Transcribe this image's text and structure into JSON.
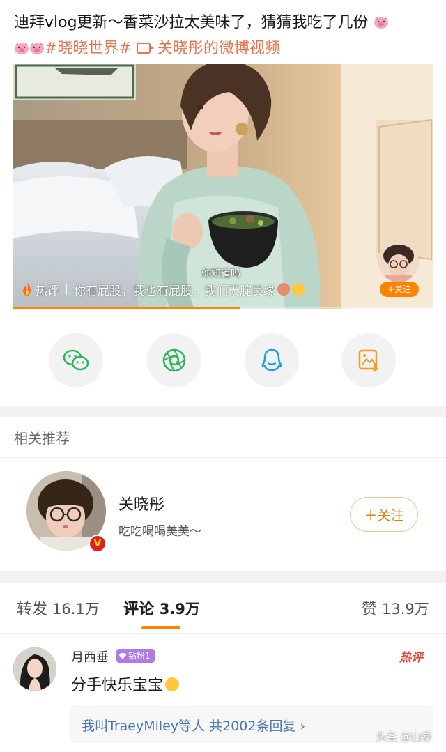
{
  "post": {
    "line1": "迪拜vlog更新～香菜沙拉太美味了，猜猜我吃了几份",
    "topic": "#晓晓世界#",
    "video_link": "关晓彤的微博视频"
  },
  "video": {
    "caption": "你知道吗",
    "hot_label": "热评",
    "hot_comment": "你有屁股，我也有屁股，我们天腚良缘",
    "follow_label": "+关注",
    "progress": 0.54
  },
  "share": {
    "wechat": "wechat-icon",
    "moments": "moments-icon",
    "qq": "qq-icon",
    "save": "save-image-icon"
  },
  "recommend": {
    "title": "相关推荐",
    "name": "关晓彤",
    "desc": "吃吃喝喝美美～",
    "follow_label": "＋关注"
  },
  "tabs": {
    "repost_label": "转发",
    "repost_count": "16.1万",
    "comment_label": "评论",
    "comment_count": "3.9万",
    "like_label": "赞",
    "like_count": "13.9万"
  },
  "comment": {
    "user": "月西垂",
    "badge": "钻粉1",
    "hot_tag": "热评",
    "text": "分手快乐宝宝",
    "replies": "我叫TraeyMiley等人  共2002条回复  ›"
  },
  "watermark": "头条 @山参",
  "colors": {
    "accent": "#eb7350",
    "orange": "#ff8200",
    "reply_link": "#4a74b8"
  }
}
